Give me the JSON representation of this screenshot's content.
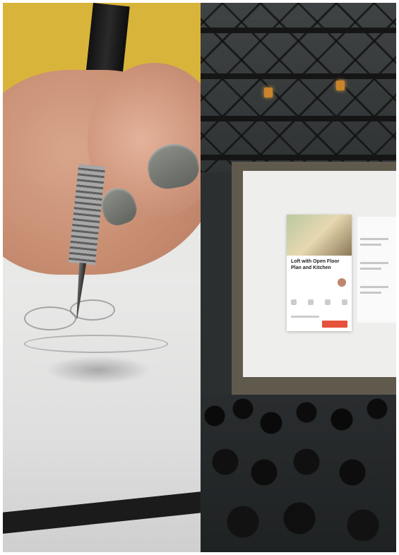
{
  "collage": {
    "left_panel": {
      "subject": "hand sketching with mechanical pencil",
      "background_color": "#d9b43a",
      "paper_color": "#e9e9e8",
      "nail_color": "#7b7d77"
    },
    "right_panel": {
      "subject": "audience watching app presentation on large screen",
      "screen_card": {
        "title": "Loft with Open Floor Plan and Kitchen",
        "accent_color": "#e5533c"
      }
    }
  }
}
